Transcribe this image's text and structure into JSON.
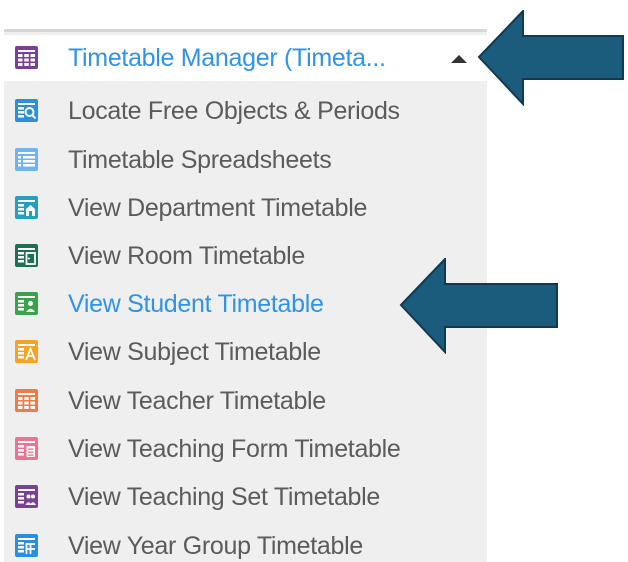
{
  "menu": {
    "header": {
      "label": "Timetable Manager (Timeta...",
      "icon": "grid-icon",
      "color": "#7b3f98"
    },
    "items": [
      {
        "label": "Locate Free Objects & Periods",
        "icon": "search-grid-icon",
        "color": "#2b8fdc"
      },
      {
        "label": "Timetable Spreadsheets",
        "icon": "spreadsheet-icon",
        "color": "#6fb4ef"
      },
      {
        "label": "View Department Timetable",
        "icon": "building-grid-icon",
        "color": "#22a0be"
      },
      {
        "label": "View Room Timetable",
        "icon": "room-grid-icon",
        "color": "#1e6e55"
      },
      {
        "label": "View Student Timetable",
        "icon": "student-grid-icon",
        "color": "#3aa24a",
        "active": true
      },
      {
        "label": "View Subject Timetable",
        "icon": "subject-grid-icon",
        "color": "#f5a324"
      },
      {
        "label": "View Teacher Timetable",
        "icon": "teacher-grid-icon",
        "color": "#f07b45"
      },
      {
        "label": "View Teaching Form Timetable",
        "icon": "form-grid-icon",
        "color": "#ee7390"
      },
      {
        "label": "View Teaching Set Timetable",
        "icon": "set-grid-icon",
        "color": "#7b3f98"
      },
      {
        "label": "View Year Group Timetable",
        "icon": "year-grid-icon",
        "color": "#2b8fdc"
      }
    ]
  },
  "annotations": {
    "arrow_color": "#1b5b7c"
  }
}
